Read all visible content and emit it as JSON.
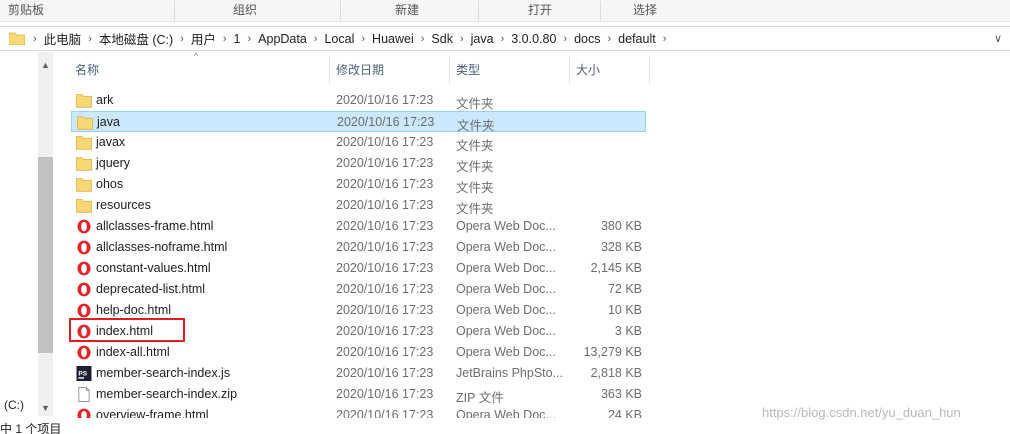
{
  "ribbon": {
    "groups": [
      "剪贴板",
      "组织",
      "新建",
      "打开",
      "选择"
    ]
  },
  "address": {
    "crumbs": [
      "此电脑",
      "本地磁盘 (C:)",
      "用户",
      "1",
      "AppData",
      "Local",
      "Huawei",
      "Sdk",
      "java",
      "3.0.0.80",
      "docs",
      "default"
    ]
  },
  "columns": {
    "name": "名称",
    "date": "修改日期",
    "type": "类型",
    "size": "大小"
  },
  "files": [
    {
      "name": "ark",
      "date": "2020/10/16 17:23",
      "type": "文件夹",
      "size": "",
      "icon": "folder-icon",
      "selected": false
    },
    {
      "name": "java",
      "date": "2020/10/16 17:23",
      "type": "文件夹",
      "size": "",
      "icon": "folder-icon",
      "selected": true
    },
    {
      "name": "javax",
      "date": "2020/10/16 17:23",
      "type": "文件夹",
      "size": "",
      "icon": "folder-icon",
      "selected": false
    },
    {
      "name": "jquery",
      "date": "2020/10/16 17:23",
      "type": "文件夹",
      "size": "",
      "icon": "folder-icon",
      "selected": false
    },
    {
      "name": "ohos",
      "date": "2020/10/16 17:23",
      "type": "文件夹",
      "size": "",
      "icon": "folder-icon",
      "selected": false
    },
    {
      "name": "resources",
      "date": "2020/10/16 17:23",
      "type": "文件夹",
      "size": "",
      "icon": "folder-icon",
      "selected": false
    },
    {
      "name": "allclasses-frame.html",
      "date": "2020/10/16 17:23",
      "type": "Opera Web Doc...",
      "size": "380 KB",
      "icon": "opera-icon",
      "selected": false
    },
    {
      "name": "allclasses-noframe.html",
      "date": "2020/10/16 17:23",
      "type": "Opera Web Doc...",
      "size": "328 KB",
      "icon": "opera-icon",
      "selected": false
    },
    {
      "name": "constant-values.html",
      "date": "2020/10/16 17:23",
      "type": "Opera Web Doc...",
      "size": "2,145 KB",
      "icon": "opera-icon",
      "selected": false
    },
    {
      "name": "deprecated-list.html",
      "date": "2020/10/16 17:23",
      "type": "Opera Web Doc...",
      "size": "72 KB",
      "icon": "opera-icon",
      "selected": false
    },
    {
      "name": "help-doc.html",
      "date": "2020/10/16 17:23",
      "type": "Opera Web Doc...",
      "size": "10 KB",
      "icon": "opera-icon",
      "selected": false
    },
    {
      "name": "index.html",
      "date": "2020/10/16 17:23",
      "type": "Opera Web Doc...",
      "size": "3 KB",
      "icon": "opera-icon",
      "selected": false
    },
    {
      "name": "index-all.html",
      "date": "2020/10/16 17:23",
      "type": "Opera Web Doc...",
      "size": "13,279 KB",
      "icon": "opera-icon",
      "selected": false
    },
    {
      "name": "member-search-index.js",
      "date": "2020/10/16 17:23",
      "type": "JetBrains PhpSto...",
      "size": "2,818 KB",
      "icon": "phpstorm-icon",
      "selected": false
    },
    {
      "name": "member-search-index.zip",
      "date": "2020/10/16 17:23",
      "type": "ZIP 文件",
      "size": "363 KB",
      "icon": "zip-file-icon",
      "selected": false
    },
    {
      "name": "overview-frame.html",
      "date": "2020/10/16 17:23",
      "type": "Opera Web Doc...",
      "size": "24 KB",
      "icon": "opera-icon",
      "selected": false
    }
  ],
  "nav": {
    "drive_label": "(C:)"
  },
  "status": {
    "text": "中 1 个项目"
  },
  "watermark": "https://blog.csdn.net/yu_duan_hun",
  "colors": {
    "selection": "#cce8ff",
    "highlight_box": "#e02020",
    "folder": "#f8d775",
    "opera": "#e0262b"
  }
}
